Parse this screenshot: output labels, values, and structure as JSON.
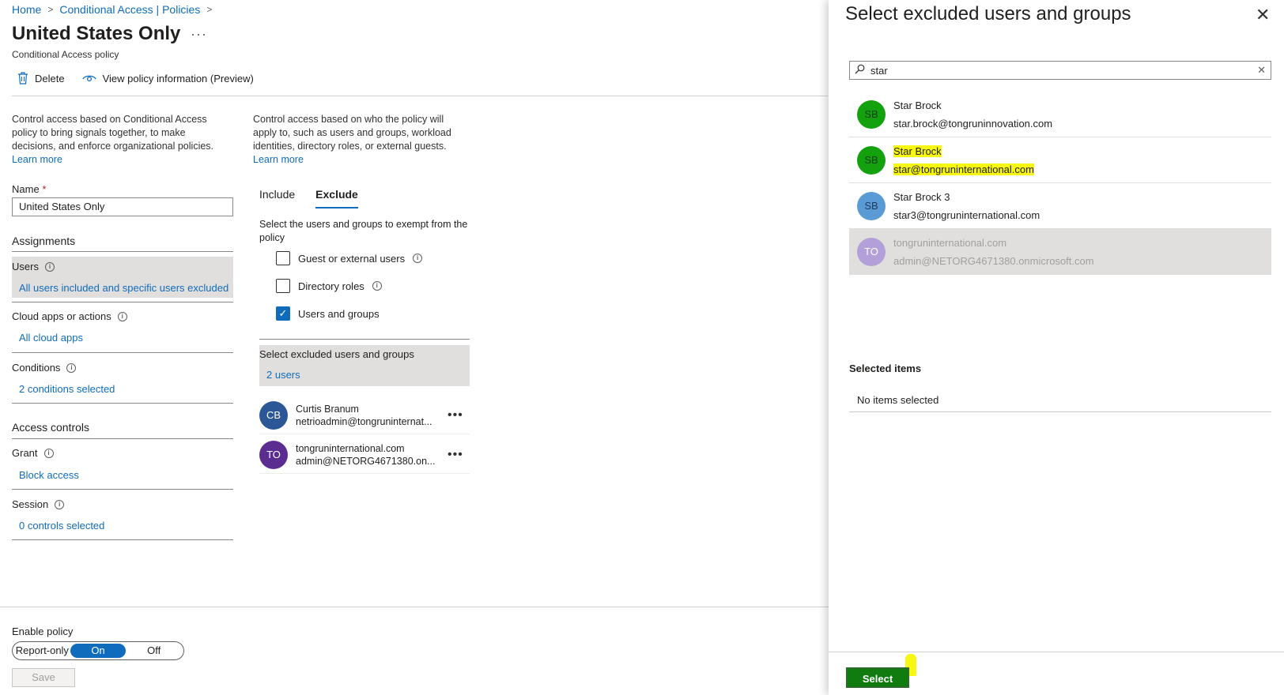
{
  "breadcrumb": {
    "home": "Home",
    "policies": "Conditional Access | Policies"
  },
  "page": {
    "title": "United States Only",
    "more": "···",
    "subtitle": "Conditional Access policy"
  },
  "toolbar": {
    "delete_label": "Delete",
    "view_info_label": "View policy information (Preview)"
  },
  "left": {
    "description": "Control access based on Conditional Access policy to bring signals together, to make decisions, and enforce organizational policies.",
    "learn_more": "Learn more",
    "name_label": "Name",
    "name_required": "*",
    "name_value": "United States Only",
    "assignments_heading": "Assignments",
    "users_label": "Users",
    "users_value": "All users included and specific users excluded",
    "cloud_label": "Cloud apps or actions",
    "cloud_value": "All cloud apps",
    "conditions_label": "Conditions",
    "conditions_value": "2 conditions selected",
    "access_heading": "Access controls",
    "grant_label": "Grant",
    "grant_value": "Block access",
    "session_label": "Session",
    "session_value": "0 controls selected"
  },
  "middle": {
    "description": "Control access based on who the policy will apply to, such as users and groups, workload identities, directory roles, or external guests.",
    "learn_more": "Learn more",
    "tab_include": "Include",
    "tab_exclude": "Exclude",
    "exempt_text": "Select the users and groups to exempt from the policy",
    "opt_guest": "Guest or external users",
    "opt_roles": "Directory roles",
    "opt_users": "Users and groups",
    "excluded_title": "Select excluded users and groups",
    "excluded_value": "2 users",
    "excluded": [
      {
        "initials": "CB",
        "name": "Curtis Branum",
        "email": "netrioadmin@tongruninternat...",
        "color": "#2b5797"
      },
      {
        "initials": "TO",
        "name": "tongruninternational.com",
        "email": "admin@NETORG4671380.on...",
        "color": "#5c2d91"
      }
    ]
  },
  "bottom": {
    "enable_label": "Enable policy",
    "toggle_report": "Report-only",
    "toggle_on": "On",
    "toggle_off": "Off",
    "save_label": "Save"
  },
  "panel": {
    "title": "Select excluded users and groups",
    "close": "✕",
    "search_value": "star",
    "results": [
      {
        "initials": "SB",
        "name": "Star Brock",
        "email": "star.brock@tongruninnovation.com",
        "color": "#13a10e"
      },
      {
        "initials": "SB",
        "name": "Star Brock",
        "email": "star@tongruninternational.com",
        "color": "#13a10e"
      },
      {
        "initials": "SB",
        "name": "Star Brock 3",
        "email": "star3@tongruninternational.com",
        "color": "#5b9bd5"
      },
      {
        "initials": "TO",
        "name": "tongruninternational.com",
        "email": "admin@NETORG4671380.onmicrosoft.com",
        "color": "#b4a0d8"
      }
    ],
    "selected_heading": "Selected items",
    "selected_empty": "No items selected",
    "select_label": "Select"
  }
}
